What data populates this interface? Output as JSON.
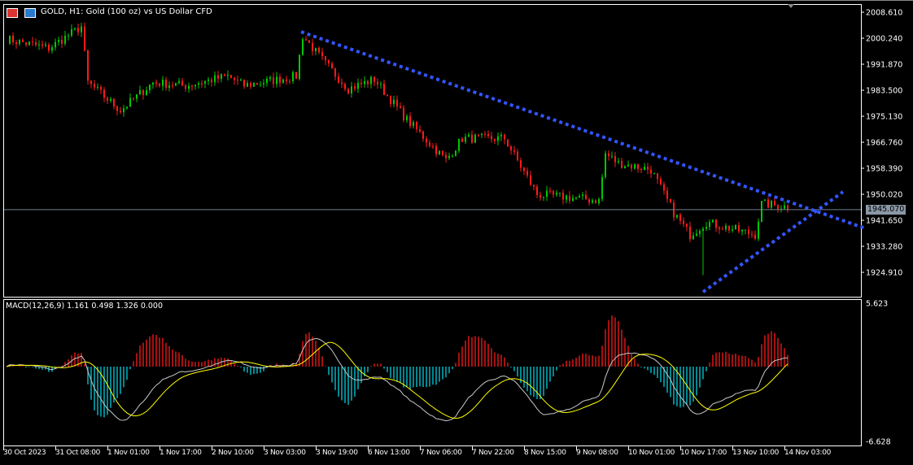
{
  "header": {
    "title": "GOLD, H1:  Gold (100 oz) vs US Dollar CFD"
  },
  "price_axis": [
    "2008.610",
    "2000.240",
    "1991.870",
    "1983.500",
    "1975.130",
    "1966.760",
    "1958.390",
    "1950.020",
    "1941.650",
    "1933.280",
    "1924.910"
  ],
  "current_price": "1945.070",
  "macd": {
    "label": "MACD(12,26,9) 1.161 0.498 1.326 0.000",
    "axis_max": "5.623",
    "axis_min": "-6.628"
  },
  "time_axis": [
    "30 Oct 2023",
    "31 Oct 08:00",
    "1 Nov 01:00",
    "1 Nov 17:00",
    "2 Nov 10:00",
    "3 Nov 03:00",
    "3 Nov 19:00",
    "6 Nov 13:00",
    "7 Nov 06:00",
    "7 Nov 22:00",
    "8 Nov 15:00",
    "9 Nov 08:00",
    "10 Nov 01:00",
    "10 Nov 17:00",
    "13 Nov 10:00",
    "14 Nov 03:00"
  ],
  "colors": {
    "up": "#00c800",
    "down": "#ff1a1a",
    "trend": "#3355ff",
    "macd_main": "#c8c8c8",
    "macd_signal": "#ffff00",
    "hist_pos": "#ff1a1a",
    "hist_neg": "#00d0e0",
    "price_line": "#6f7f91"
  },
  "chart_data": {
    "type": "candlestick",
    "symbol": "GOLD",
    "timeframe": "H1",
    "ylim": [
      1916,
      2010
    ],
    "close_path": [
      [
        0,
        2000
      ],
      [
        13,
        1997
      ],
      [
        23,
        2004
      ],
      [
        25,
        1986
      ],
      [
        35,
        1977
      ],
      [
        45,
        1986
      ],
      [
        55,
        1985
      ],
      [
        68,
        1988
      ],
      [
        73,
        1985
      ],
      [
        89,
        1988
      ],
      [
        91,
        2001
      ],
      [
        98,
        1992
      ],
      [
        105,
        1984
      ],
      [
        113,
        1987
      ],
      [
        123,
        1974
      ],
      [
        135,
        1961
      ],
      [
        140,
        1968
      ],
      [
        153,
        1968
      ],
      [
        163,
        1950
      ],
      [
        173,
        1949
      ],
      [
        182,
        1948
      ],
      [
        184,
        1963
      ],
      [
        188,
        1960
      ],
      [
        198,
        1958
      ],
      [
        205,
        1944
      ],
      [
        210,
        1937
      ],
      [
        215,
        1941
      ],
      [
        230,
        1937
      ],
      [
        232,
        1947
      ],
      [
        240,
        1946
      ]
    ],
    "spike_low": [
      214,
      1924
    ],
    "trendlines": [
      [
        [
          90.5,
          2002.3
        ],
        [
          264,
          1939
        ]
      ],
      [
        [
          214,
          1918.6
        ],
        [
          257,
          1950.8
        ]
      ]
    ]
  }
}
